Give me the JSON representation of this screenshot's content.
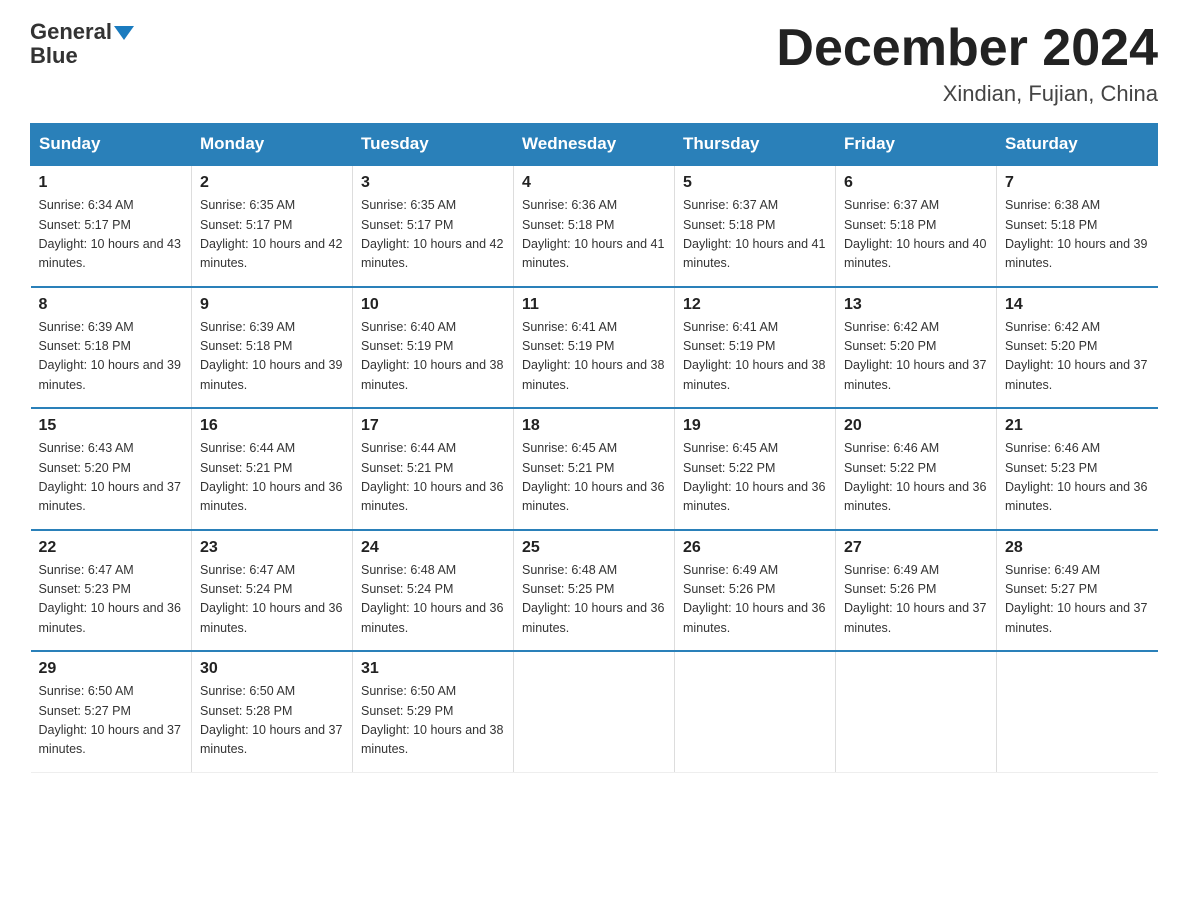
{
  "header": {
    "logo_general": "General",
    "logo_blue": "Blue",
    "month_title": "December 2024",
    "location": "Xindian, Fujian, China"
  },
  "days_of_week": [
    "Sunday",
    "Monday",
    "Tuesday",
    "Wednesday",
    "Thursday",
    "Friday",
    "Saturday"
  ],
  "weeks": [
    [
      {
        "day": "1",
        "sunrise": "6:34 AM",
        "sunset": "5:17 PM",
        "daylight": "10 hours and 43 minutes."
      },
      {
        "day": "2",
        "sunrise": "6:35 AM",
        "sunset": "5:17 PM",
        "daylight": "10 hours and 42 minutes."
      },
      {
        "day": "3",
        "sunrise": "6:35 AM",
        "sunset": "5:17 PM",
        "daylight": "10 hours and 42 minutes."
      },
      {
        "day": "4",
        "sunrise": "6:36 AM",
        "sunset": "5:18 PM",
        "daylight": "10 hours and 41 minutes."
      },
      {
        "day": "5",
        "sunrise": "6:37 AM",
        "sunset": "5:18 PM",
        "daylight": "10 hours and 41 minutes."
      },
      {
        "day": "6",
        "sunrise": "6:37 AM",
        "sunset": "5:18 PM",
        "daylight": "10 hours and 40 minutes."
      },
      {
        "day": "7",
        "sunrise": "6:38 AM",
        "sunset": "5:18 PM",
        "daylight": "10 hours and 39 minutes."
      }
    ],
    [
      {
        "day": "8",
        "sunrise": "6:39 AM",
        "sunset": "5:18 PM",
        "daylight": "10 hours and 39 minutes."
      },
      {
        "day": "9",
        "sunrise": "6:39 AM",
        "sunset": "5:18 PM",
        "daylight": "10 hours and 39 minutes."
      },
      {
        "day": "10",
        "sunrise": "6:40 AM",
        "sunset": "5:19 PM",
        "daylight": "10 hours and 38 minutes."
      },
      {
        "day": "11",
        "sunrise": "6:41 AM",
        "sunset": "5:19 PM",
        "daylight": "10 hours and 38 minutes."
      },
      {
        "day": "12",
        "sunrise": "6:41 AM",
        "sunset": "5:19 PM",
        "daylight": "10 hours and 38 minutes."
      },
      {
        "day": "13",
        "sunrise": "6:42 AM",
        "sunset": "5:20 PM",
        "daylight": "10 hours and 37 minutes."
      },
      {
        "day": "14",
        "sunrise": "6:42 AM",
        "sunset": "5:20 PM",
        "daylight": "10 hours and 37 minutes."
      }
    ],
    [
      {
        "day": "15",
        "sunrise": "6:43 AM",
        "sunset": "5:20 PM",
        "daylight": "10 hours and 37 minutes."
      },
      {
        "day": "16",
        "sunrise": "6:44 AM",
        "sunset": "5:21 PM",
        "daylight": "10 hours and 36 minutes."
      },
      {
        "day": "17",
        "sunrise": "6:44 AM",
        "sunset": "5:21 PM",
        "daylight": "10 hours and 36 minutes."
      },
      {
        "day": "18",
        "sunrise": "6:45 AM",
        "sunset": "5:21 PM",
        "daylight": "10 hours and 36 minutes."
      },
      {
        "day": "19",
        "sunrise": "6:45 AM",
        "sunset": "5:22 PM",
        "daylight": "10 hours and 36 minutes."
      },
      {
        "day": "20",
        "sunrise": "6:46 AM",
        "sunset": "5:22 PM",
        "daylight": "10 hours and 36 minutes."
      },
      {
        "day": "21",
        "sunrise": "6:46 AM",
        "sunset": "5:23 PM",
        "daylight": "10 hours and 36 minutes."
      }
    ],
    [
      {
        "day": "22",
        "sunrise": "6:47 AM",
        "sunset": "5:23 PM",
        "daylight": "10 hours and 36 minutes."
      },
      {
        "day": "23",
        "sunrise": "6:47 AM",
        "sunset": "5:24 PM",
        "daylight": "10 hours and 36 minutes."
      },
      {
        "day": "24",
        "sunrise": "6:48 AM",
        "sunset": "5:24 PM",
        "daylight": "10 hours and 36 minutes."
      },
      {
        "day": "25",
        "sunrise": "6:48 AM",
        "sunset": "5:25 PM",
        "daylight": "10 hours and 36 minutes."
      },
      {
        "day": "26",
        "sunrise": "6:49 AM",
        "sunset": "5:26 PM",
        "daylight": "10 hours and 36 minutes."
      },
      {
        "day": "27",
        "sunrise": "6:49 AM",
        "sunset": "5:26 PM",
        "daylight": "10 hours and 37 minutes."
      },
      {
        "day": "28",
        "sunrise": "6:49 AM",
        "sunset": "5:27 PM",
        "daylight": "10 hours and 37 minutes."
      }
    ],
    [
      {
        "day": "29",
        "sunrise": "6:50 AM",
        "sunset": "5:27 PM",
        "daylight": "10 hours and 37 minutes."
      },
      {
        "day": "30",
        "sunrise": "6:50 AM",
        "sunset": "5:28 PM",
        "daylight": "10 hours and 37 minutes."
      },
      {
        "day": "31",
        "sunrise": "6:50 AM",
        "sunset": "5:29 PM",
        "daylight": "10 hours and 38 minutes."
      },
      null,
      null,
      null,
      null
    ]
  ]
}
